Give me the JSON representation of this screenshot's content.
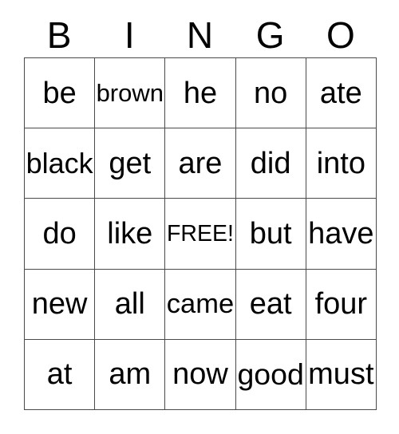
{
  "card": {
    "title": "BINGO",
    "headers": [
      "B",
      "I",
      "N",
      "G",
      "O"
    ],
    "free_space_label": "FREE!",
    "free_space_position": {
      "row": 2,
      "col": 2
    },
    "grid_size": "5x5",
    "colors": {
      "background": "#ffffff",
      "text": "#000000",
      "border": "#4a4a4a"
    },
    "rows": [
      {
        "cells": [
          {
            "text": "be"
          },
          {
            "text": "brown"
          },
          {
            "text": "he"
          },
          {
            "text": "no"
          },
          {
            "text": "ate"
          }
        ]
      },
      {
        "cells": [
          {
            "text": "black"
          },
          {
            "text": "get"
          },
          {
            "text": "are"
          },
          {
            "text": "did"
          },
          {
            "text": "into"
          }
        ]
      },
      {
        "cells": [
          {
            "text": "do"
          },
          {
            "text": "like"
          },
          {
            "text": "FREE!"
          },
          {
            "text": "but"
          },
          {
            "text": "have"
          }
        ]
      },
      {
        "cells": [
          {
            "text": "new"
          },
          {
            "text": "all"
          },
          {
            "text": "came"
          },
          {
            "text": "eat"
          },
          {
            "text": "four"
          }
        ]
      },
      {
        "cells": [
          {
            "text": "at"
          },
          {
            "text": "am"
          },
          {
            "text": "now"
          },
          {
            "text": "good"
          },
          {
            "text": "must"
          }
        ]
      }
    ]
  }
}
